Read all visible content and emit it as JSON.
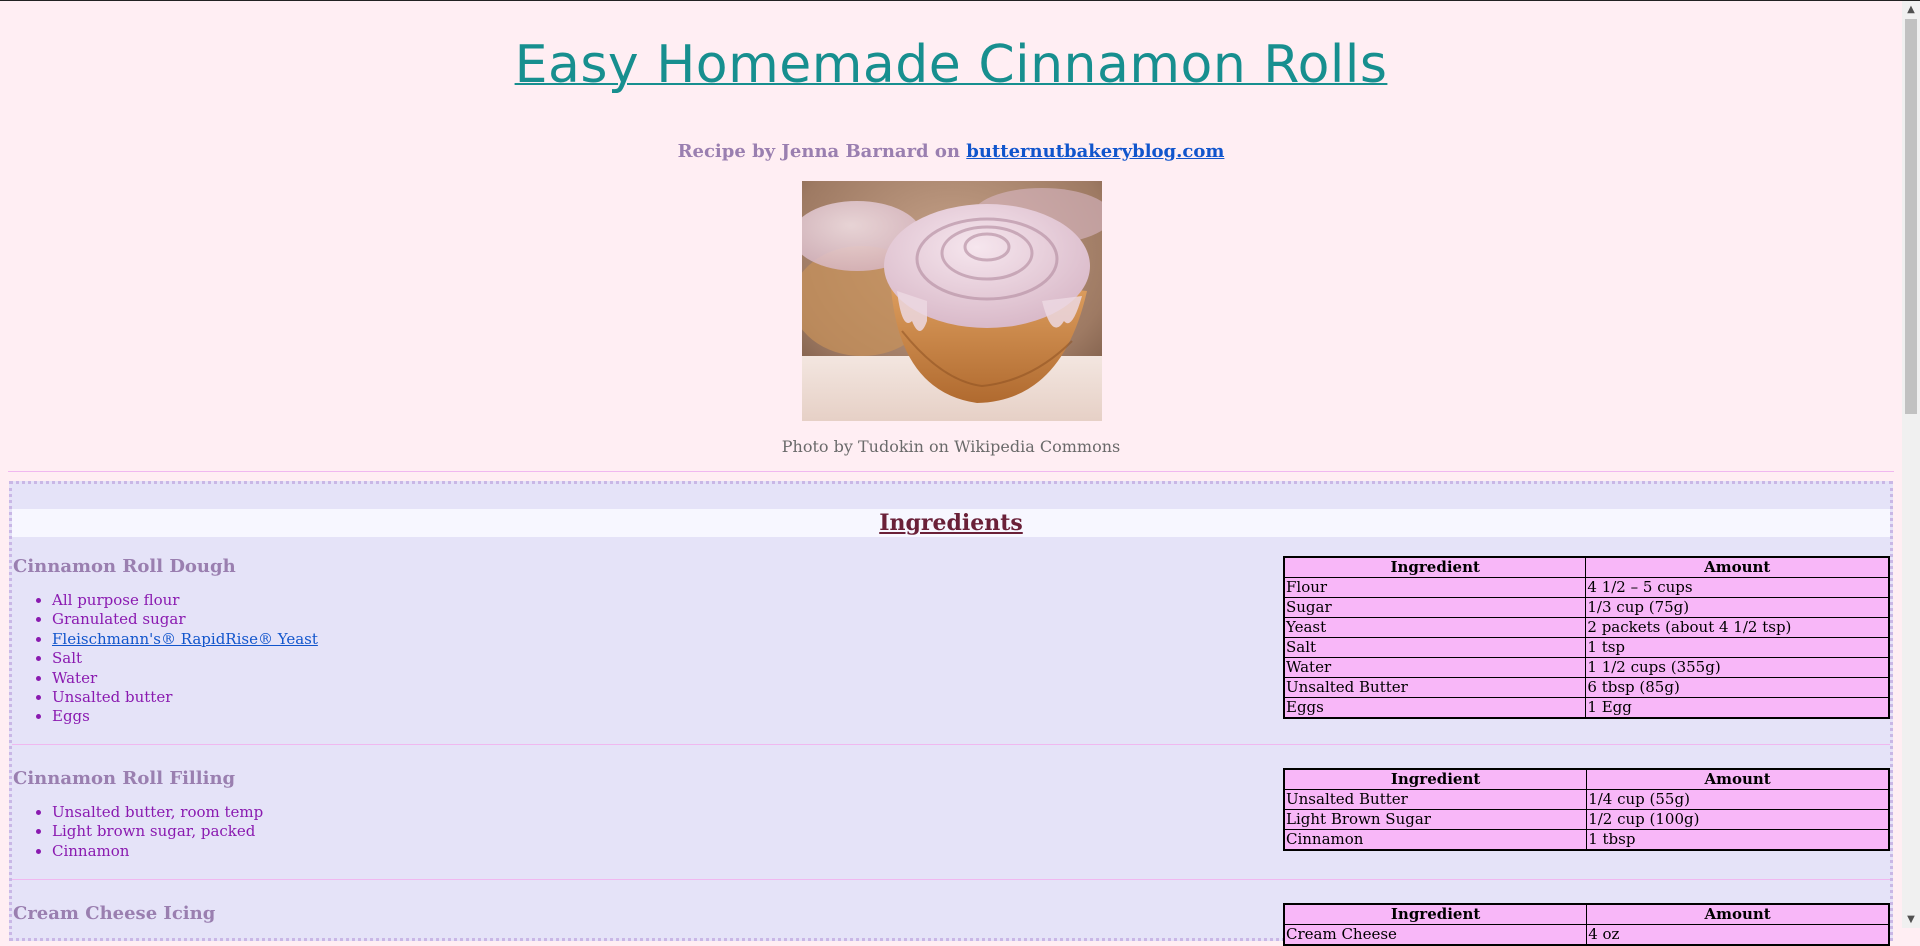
{
  "title": "Easy Homemade Cinnamon Rolls",
  "byline": {
    "prefix": "Recipe by Jenna Barnard on",
    "link": "butternutbakeryblog.com"
  },
  "photo_caption": "Photo by Tudokin on Wikipedia Commons",
  "ingredients_heading": "Ingredients",
  "sections": [
    {
      "title": "Cinnamon Roll Dough",
      "items": [
        "All purpose flour",
        "Granulated sugar",
        "Fleischmann's® RapidRise® Yeast",
        "Salt",
        "Water",
        "Unsalted butter",
        "Eggs"
      ],
      "table": {
        "headers": [
          "Ingredient",
          "Amount"
        ],
        "rows": [
          [
            "Flour",
            "4 1/2 – 5 cups"
          ],
          [
            "Sugar",
            "1/3 cup (75g)"
          ],
          [
            "Yeast",
            "2 packets (about 4 1/2 tsp)"
          ],
          [
            "Salt",
            "1 tsp"
          ],
          [
            "Water",
            "1 1/2 cups (355g)"
          ],
          [
            "Unsalted Butter",
            "6 tbsp (85g)"
          ],
          [
            "Eggs",
            "1 Egg"
          ]
        ]
      }
    },
    {
      "title": "Cinnamon Roll Filling",
      "items": [
        "Unsalted butter, room temp",
        "Light brown sugar, packed",
        "Cinnamon"
      ],
      "table": {
        "headers": [
          "Ingredient",
          "Amount"
        ],
        "rows": [
          [
            "Unsalted Butter",
            "1/4 cup (55g)"
          ],
          [
            "Light Brown Sugar",
            "1/2 cup (100g)"
          ],
          [
            "Cinnamon",
            "1 tbsp"
          ]
        ]
      }
    },
    {
      "title": "Cream Cheese Icing",
      "items": [],
      "table": {
        "headers": [
          "Ingredient",
          "Amount"
        ],
        "rows": [
          [
            "Cream Cheese",
            "4 oz"
          ]
        ]
      }
    }
  ],
  "colors": {
    "background": "#ffeef3",
    "title": "#178f8f",
    "byline": "#9a7fb0",
    "link": "#1155cc",
    "list": "#8a1ab0",
    "panel": "#e5e3f8",
    "table": "#f8b7f8"
  }
}
